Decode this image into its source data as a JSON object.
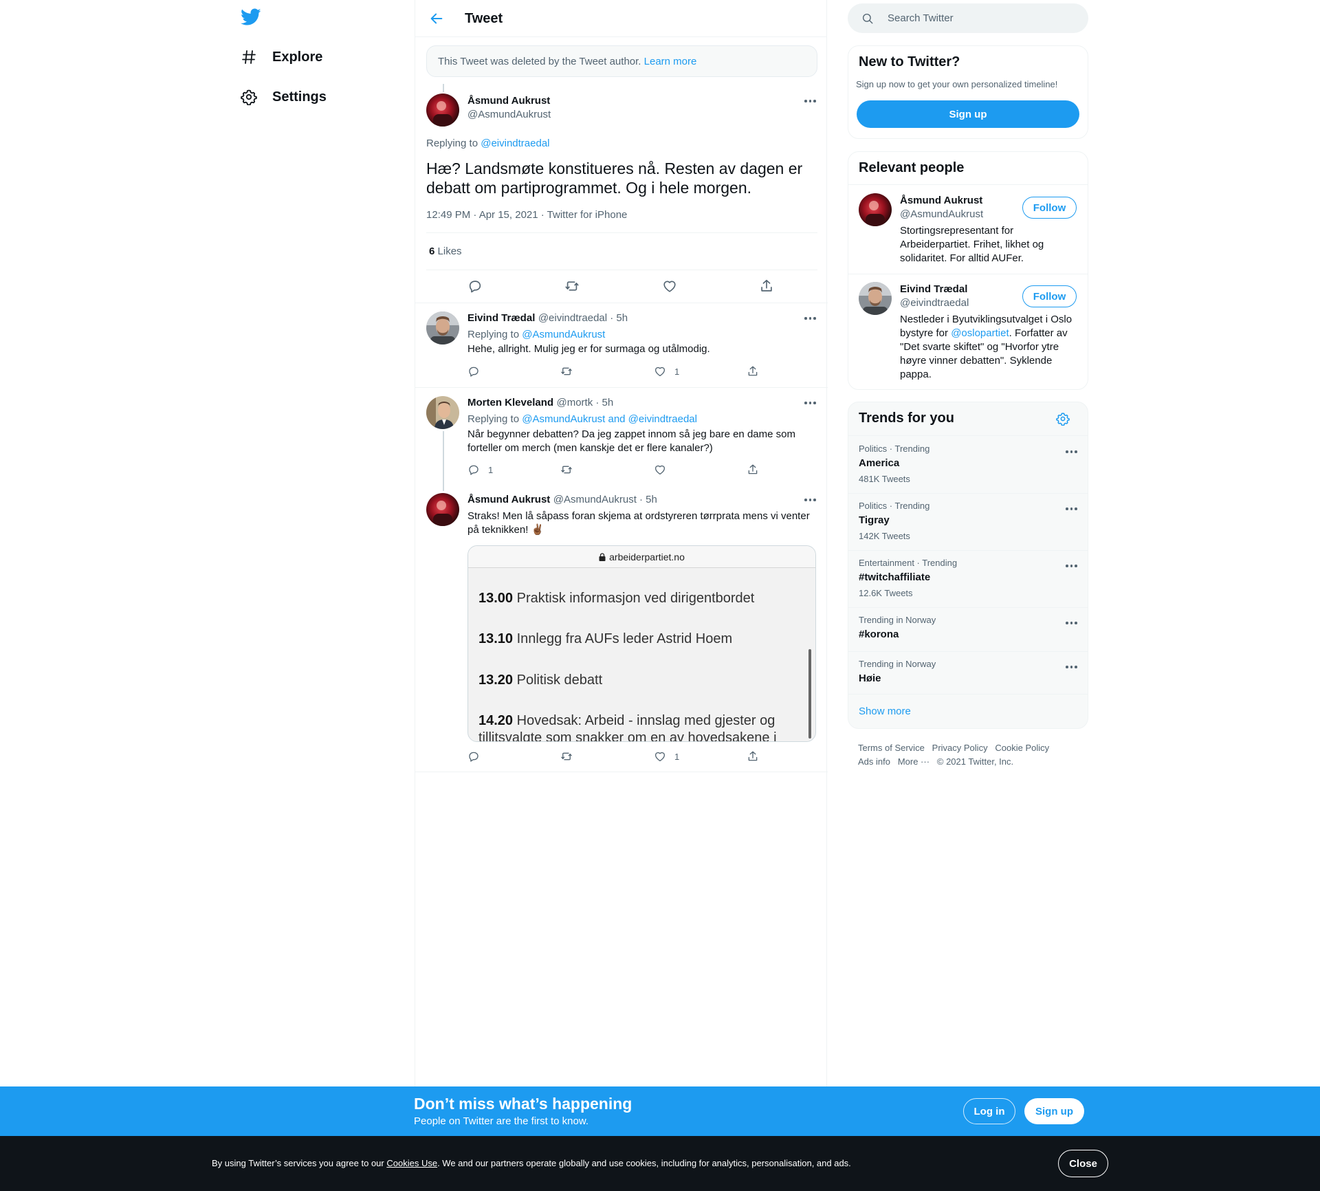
{
  "nav": {
    "items": [
      {
        "label": "Explore",
        "icon": "hashtag-icon"
      },
      {
        "label": "Settings",
        "icon": "gear-icon"
      }
    ]
  },
  "header": {
    "title": "Tweet"
  },
  "deleted_notice": {
    "text": "This Tweet was deleted by the Tweet author.",
    "link": "Learn more"
  },
  "main_tweet": {
    "name": "Åsmund Aukrust",
    "handle": "@AsmundAukrust",
    "replying_prefix": "Replying to",
    "replying_to": "@eivindtraedal",
    "text": "Hæ? Landsmøte konstitueres nå. Resten av dagen er debatt om partiprogrammet. Og i hele morgen.",
    "timestamp": "12:49 PM · Apr 15, 2021 · Twitter for iPhone",
    "likes_count": "6",
    "likes_label": "Likes"
  },
  "replies": [
    {
      "name": "Eivind Trædal",
      "handle_time": "@eivindtraedal · 5h",
      "replying_prefix": "Replying to",
      "replying_to": "@AsmundAukrust",
      "text": "Hehe, allright. Mulig jeg er for surmaga og utålmodig.",
      "reply_count": "",
      "like_count": "1"
    },
    {
      "name": "Morten Kleveland",
      "handle_time": "@mortk · 5h",
      "replying_prefix": "Replying to",
      "replying_to": "@AsmundAukrust and @eivindtraedal",
      "text": "Når begynner debatten? Da jeg zappet innom så jeg bare en dame som forteller om merch (men kanskje det er flere kanaler?)",
      "reply_count": "1",
      "like_count": ""
    },
    {
      "name": "Åsmund Aukrust",
      "handle_time": "@AsmundAukrust · 5h",
      "text": "Straks! Men lå såpass foran skjema at ordstyreren tørrprata mens vi venter på teknikken! ✌🏾",
      "reply_count": "",
      "like_count": "1"
    }
  ],
  "embedded_image": {
    "url": "arbeiderpartiet.no",
    "rows": [
      {
        "time": "13.00",
        "text": "Praktisk informasjon ved dirigentbordet"
      },
      {
        "time": "13.10",
        "text": " Innlegg fra AUFs leder Astrid Hoem"
      },
      {
        "time": "13.20",
        "text": "Politisk debatt"
      },
      {
        "time": "14.20",
        "text": "Hovedsak: Arbeid - innslag med gjester og"
      },
      {
        "time": "",
        "text": "tillitsvalgte som snakker om en av hovedsakene i"
      }
    ]
  },
  "search": {
    "placeholder": "Search Twitter"
  },
  "new_to_twitter": {
    "title": "New to Twitter?",
    "subtitle": "Sign up now to get your own personalized timeline!",
    "button": "Sign up"
  },
  "relevant_people": {
    "title": "Relevant people",
    "follow_label": "Follow",
    "people": [
      {
        "name": "Åsmund Aukrust",
        "handle": "@AsmundAukrust",
        "bio": "Stortingsrepresentant for Arbeiderpartiet. Frihet, likhet og solidaritet. For alltid AUFer."
      },
      {
        "name": "Eivind Trædal",
        "handle": "@eivindtraedal",
        "bio_before": "Nestleder i Byutviklingsutvalget i Oslo bystyre for ",
        "bio_link": "@oslopartiet",
        "bio_after": ". Forfatter av \"Det svarte skiftet\" og \"Hvorfor ytre høyre vinner debatten\". Syklende pappa."
      }
    ]
  },
  "trends": {
    "title": "Trends for you",
    "items": [
      {
        "context": "Politics · Trending",
        "name": "America",
        "count": "481K Tweets"
      },
      {
        "context": "Politics · Trending",
        "name": "Tigray",
        "count": "142K Tweets"
      },
      {
        "context": "Entertainment · Trending",
        "name": "#twitchaffiliate",
        "count": "12.6K Tweets"
      },
      {
        "context": "Trending in Norway",
        "name": "#korona",
        "count": ""
      },
      {
        "context": "Trending in Norway",
        "name": "Høie",
        "count": ""
      }
    ],
    "show_more": "Show more"
  },
  "footer": {
    "links": [
      "Terms of Service",
      "Privacy Policy",
      "Cookie Policy",
      "Ads info",
      "More ···"
    ],
    "copyright": "© 2021 Twitter, Inc."
  },
  "banner": {
    "headline": "Don’t miss what’s happening",
    "sub": "People on Twitter are the first to know.",
    "login": "Log in",
    "signup": "Sign up"
  },
  "cookie": {
    "text_before": "By using Twitter’s services you agree to our ",
    "link": "Cookies Use",
    "text_after": ". We and our partners operate globally and use cookies, including for analytics, personalisation, and ads.",
    "close": "Close"
  },
  "colors": {
    "accent": "#1d9bf0",
    "text": "#0f1419",
    "secondary": "#536471",
    "cookie_bg": "#0f1419"
  }
}
